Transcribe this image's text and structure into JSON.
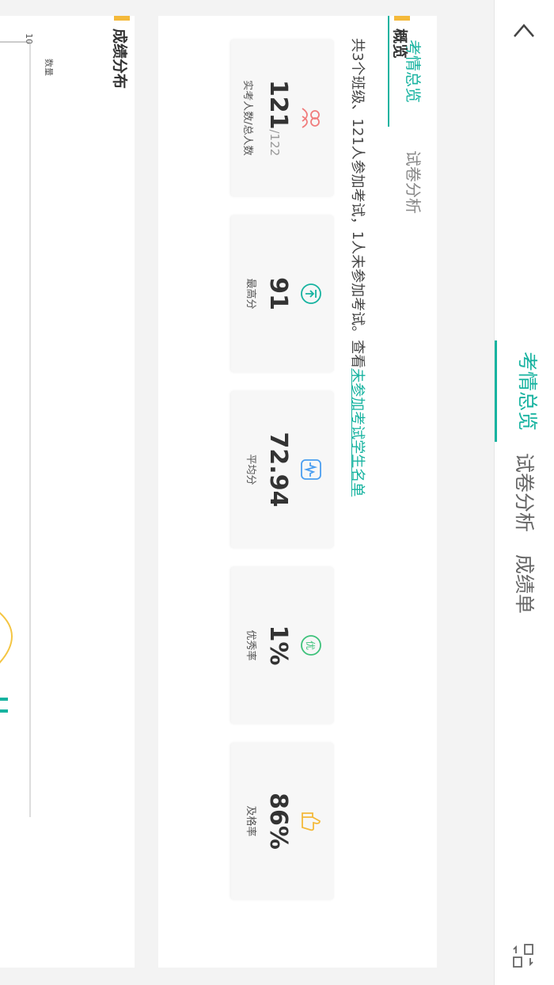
{
  "nav": {
    "tabs": [
      "考情总览",
      "试卷分析",
      "成绩单"
    ],
    "active_tab": 0,
    "accent_color": "#17b3a0"
  },
  "overview": {
    "sub_tabs": [
      "考情总览",
      "试卷分析"
    ],
    "title": "概览",
    "summary_text": "共3个班级、121人参加考试，1人未参加考试。查看",
    "summary_link": "未参加考试学生名单",
    "cards": [
      {
        "icon": "people-icon",
        "value": "121",
        "total": "/122",
        "label": "实考人数/总人数",
        "color": "#f07b7b"
      },
      {
        "icon": "highest-score-icon",
        "value": "91",
        "label": "最高分",
        "color": "#17b3a0"
      },
      {
        "icon": "average-score-icon",
        "value": "72.94",
        "label": "平均分",
        "color": "#4a9ef0"
      },
      {
        "icon": "excellent-rate-icon",
        "value": "1%",
        "label": "优秀率",
        "color": "#3ec27b"
      },
      {
        "icon": "pass-rate-icon",
        "value": "86%",
        "label": "及格率",
        "color": "#f4b93a"
      }
    ]
  },
  "distribution": {
    "title": "成绩分布",
    "ylabel": "数量",
    "y_tick": "10",
    "curve_color": "#f4c542",
    "bar_color": "#17b3a0"
  }
}
